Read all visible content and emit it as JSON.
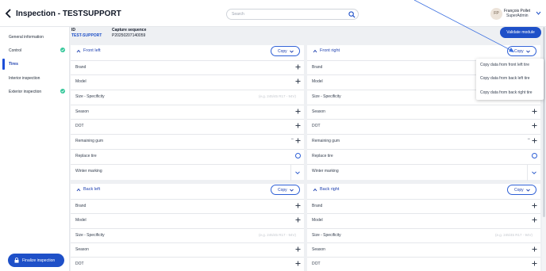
{
  "header": {
    "title": "Inspection - TESTSUPPORT",
    "search_placeholder": "Search",
    "user_initials": "FP",
    "user_name": "François Pollet",
    "user_role": "SuperAdmin"
  },
  "sidebar": {
    "items": [
      {
        "label": "General information",
        "active": false,
        "complete": false
      },
      {
        "label": "Control",
        "active": false,
        "complete": true
      },
      {
        "label": "Tires",
        "active": true,
        "complete": false
      },
      {
        "label": "Interior inspection",
        "active": false,
        "complete": false
      },
      {
        "label": "Exterior inspection",
        "active": false,
        "complete": true
      }
    ],
    "finalize_label": "Finalize inspection"
  },
  "info": {
    "id_label": "ID",
    "id_value": "TEST-SUPPORT",
    "capture_label": "Capture sequence",
    "capture_value": "P20250207140059",
    "validate_label": "Validate module"
  },
  "copy_label": "Copy",
  "placeholder_size": "(e.g. 245/45 R17 - 94V)",
  "cards": {
    "front_left": {
      "title": "Front left",
      "rows": [
        "Brand",
        "Model",
        "Size - Specificity",
        "Season",
        "DOT",
        "Remaining gum",
        "Replace tire",
        "Winter marking"
      ]
    },
    "front_right": {
      "title": "Front right",
      "rows": [
        "Brand",
        "Model",
        "Size - Specificity",
        "Season",
        "DOT",
        "Remaining gum",
        "Replace tire",
        "Winter marking"
      ]
    },
    "back_left": {
      "title": "Back left",
      "rows": [
        "Brand",
        "Model",
        "Size - Specificity",
        "Season",
        "DOT"
      ]
    },
    "back_right": {
      "title": "Back right",
      "rows": [
        "Brand",
        "Model",
        "Size - Specificity",
        "Season",
        "DOT"
      ]
    }
  },
  "copy_menu": {
    "items": [
      "Copy data from front left tire",
      "Copy data from back left tire",
      "Copy data from back right tire"
    ]
  },
  "colors": {
    "primary": "#1e50c8",
    "accent_text": "#1e40af",
    "success": "#34c79a",
    "background": "#eef0f3"
  }
}
